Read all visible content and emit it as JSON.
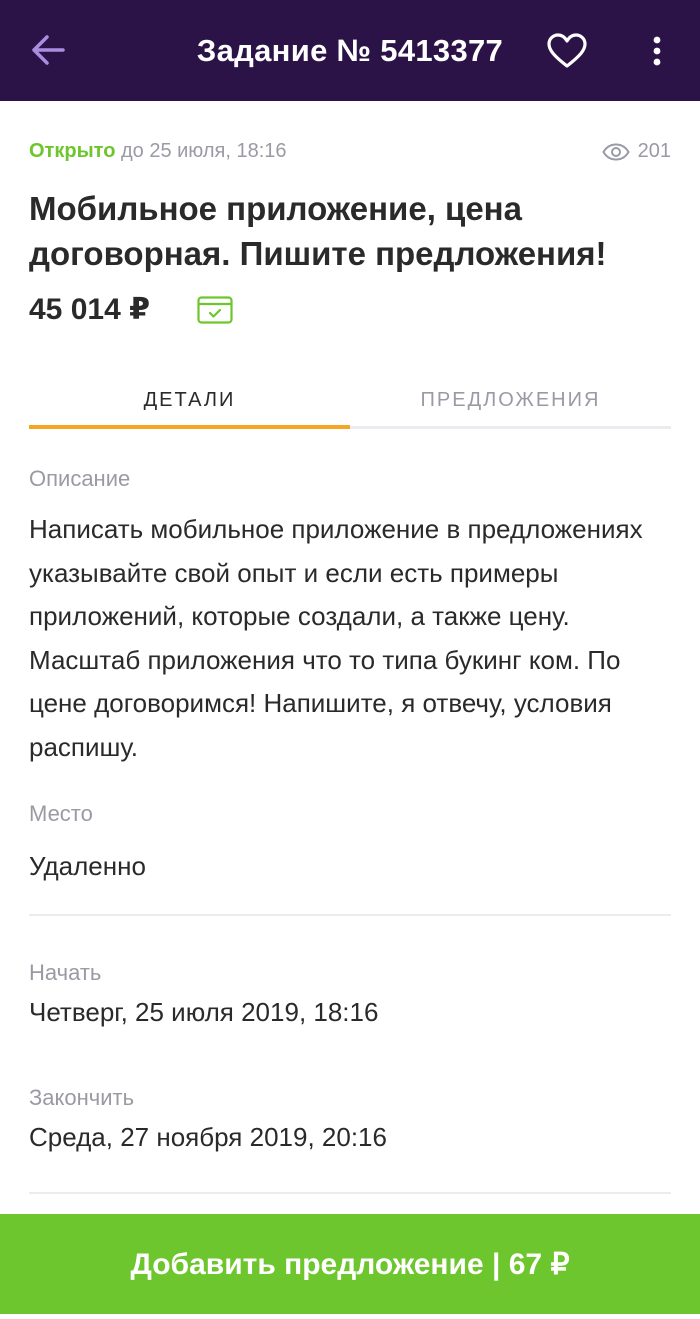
{
  "header": {
    "title": "Задание № 5413377",
    "back_icon": "arrow-left-icon",
    "favorite_icon": "heart-icon",
    "more_icon": "more-vertical-icon"
  },
  "status": {
    "state": "Открыто",
    "until": "до 25 июля, 18:16",
    "views": "201",
    "views_icon": "eye-icon"
  },
  "task": {
    "title": "Мобильное приложение, цена договорная. Пишите предложения!",
    "price": "45 014 ₽",
    "payment_icon": "card-check-icon"
  },
  "tabs": [
    {
      "label": "ДЕТАЛИ",
      "active": true
    },
    {
      "label": "ПРЕДЛОЖЕНИЯ",
      "active": false
    }
  ],
  "details": {
    "description_label": "Описание",
    "description": "Написать мобильное приложение в предложениях указывайте свой опыт и если есть примеры приложений, которые создали, а также цену. Масштаб приложения что то типа букинг ком. По цене договоримся! Напишите, я отвечу, условия распишу.",
    "place_label": "Место",
    "place": "Удаленно",
    "start_label": "Начать",
    "start": "Четверг, 25 июля 2019, 18:16",
    "end_label": "Закончить",
    "end": "Среда, 27 ноября 2019, 20:16"
  },
  "cta": {
    "label": "Добавить предложение | 67 ₽"
  },
  "colors": {
    "header_bg": "#2b1347",
    "accent_green": "#6dc62d",
    "tab_underline": "#f5a623",
    "back_arrow": "#a98ee0"
  }
}
